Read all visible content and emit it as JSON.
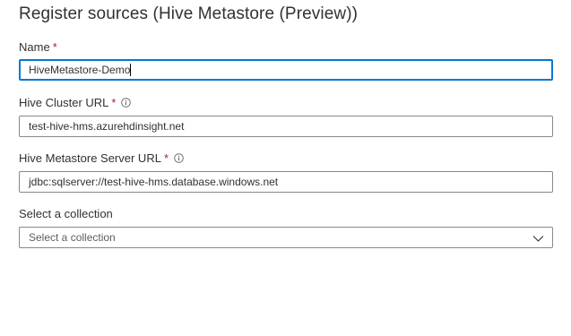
{
  "page": {
    "title": "Register sources (Hive Metastore (Preview))"
  },
  "fields": {
    "name": {
      "label": "Name",
      "required_mark": "*",
      "value": "HiveMetastore-Demo"
    },
    "cluster_url": {
      "label": "Hive Cluster URL",
      "required_mark": "*",
      "value": "test-hive-hms.azurehdinsight.net",
      "icon": "info-icon"
    },
    "metastore_url": {
      "label": "Hive Metastore Server URL",
      "required_mark": "*",
      "value": "jdbc:sqlserver://test-hive-hms.database.windows.net",
      "icon": "info-icon"
    },
    "collection": {
      "label": "Select a collection",
      "placeholder": "Select a collection",
      "icon": "chevron-down-icon"
    }
  },
  "colors": {
    "focus_border": "#0078d4",
    "required": "#a4262c",
    "border": "#8a8886",
    "text": "#323130"
  }
}
